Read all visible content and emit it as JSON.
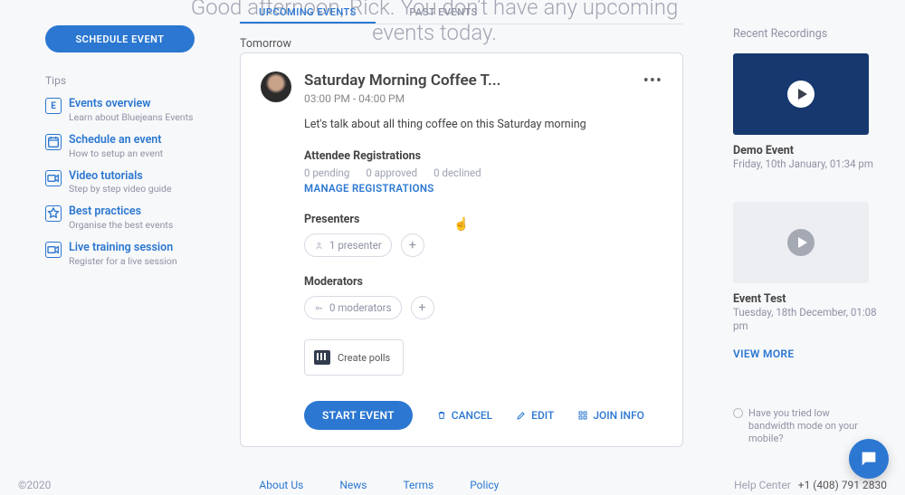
{
  "greeting": "Good afternoon, Rick. You don't have any upcoming events today.",
  "tabs": {
    "upcoming": "UPCOMING EVENTS",
    "past": "PAST EVENTS"
  },
  "sidebar": {
    "schedule_btn": "SCHEDULE EVENT",
    "tips_header": "Tips",
    "tips": [
      {
        "title": "Events overview",
        "sub": "Learn about Bluejeans Events",
        "glyph": "E"
      },
      {
        "title": "Schedule an event",
        "sub": "How to setup an event",
        "glyph": "cal"
      },
      {
        "title": "Video tutorials",
        "sub": "Step by step video guide",
        "glyph": "cam"
      },
      {
        "title": "Best practices",
        "sub": "Organise the best events",
        "glyph": "star"
      },
      {
        "title": "Live training session",
        "sub": "Register for a live session",
        "glyph": "cam"
      }
    ]
  },
  "section_header": "Tomorrow",
  "event": {
    "title": "Saturday Morning Coffee T...",
    "time": "03:00 PM - 04:00 PM",
    "desc": "Let's talk about all thing coffee on this Saturday morning",
    "reg_header": "Attendee Registrations",
    "reg_pending": "0 pending",
    "reg_approved": "0 approved",
    "reg_declined": "0 declined",
    "manage_label": "MANAGE REGISTRATIONS",
    "presenters_h": "Presenters",
    "presenters_chip": "1 presenter",
    "moderators_h": "Moderators",
    "moderators_chip": "0 moderators",
    "polls_label": "Create polls",
    "start_btn": "START EVENT",
    "cancel": "CANCEL",
    "edit": "EDIT",
    "join_info": "JOIN INFO"
  },
  "recordings": {
    "header": "Recent Recordings",
    "items": [
      {
        "title": "Demo Event",
        "sub": "Friday, 10th January, 01:34 pm"
      },
      {
        "title": "Event Test",
        "sub": "Tuesday, 18th December, 01:08 pm"
      }
    ],
    "view_more": "VIEW MORE"
  },
  "suggestion": "Have you tried low bandwidth mode on your mobile?",
  "footer": {
    "copyright": "©2020",
    "links": [
      "About Us",
      "News",
      "Terms",
      "Policy"
    ],
    "help": "Help Center",
    "phone": "+1 (408) 791 2830"
  }
}
